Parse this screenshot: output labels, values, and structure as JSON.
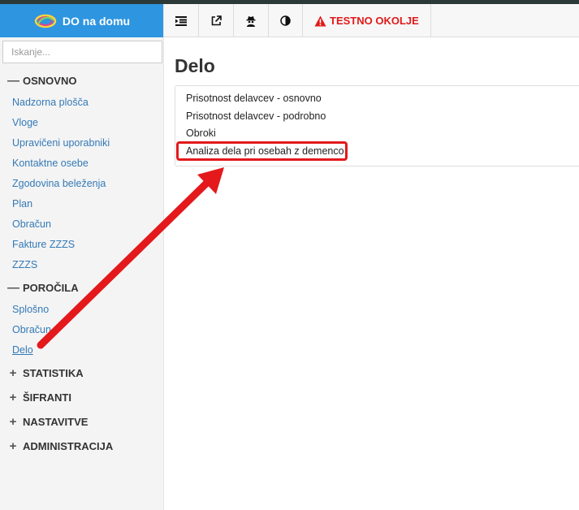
{
  "app": {
    "brand_name": "DO na domu",
    "environment_label": "TESTNO OKOLJE"
  },
  "search": {
    "placeholder": "Iskanje..."
  },
  "sidebar": {
    "sections": [
      {
        "sign": "—",
        "label": "OSNOVNO"
      },
      {
        "sign": "—",
        "label": "POROČILA"
      },
      {
        "sign": "+",
        "label": "STATISTIKA"
      },
      {
        "sign": "+",
        "label": "ŠIFRANTI"
      },
      {
        "sign": "+",
        "label": "NASTAVITVE"
      },
      {
        "sign": "+",
        "label": "ADMINISTRACIJA"
      }
    ],
    "osnovno_items": [
      "Nadzorna plošča",
      "Vloge",
      "Upravičeni uporabniki",
      "Kontaktne osebe",
      "Zgodovina beleženja",
      "Plan",
      "Obračun",
      "Fakture ZZZS",
      "ZZZS"
    ],
    "porocila_items": [
      "Splošno",
      "Obračun",
      "Delo"
    ],
    "active_item": "Delo"
  },
  "toolbar": {
    "icons": [
      "menu-toggle-icon",
      "external-link-icon",
      "user-secret-icon",
      "contrast-icon",
      "warning-icon"
    ]
  },
  "main": {
    "title": "Delo",
    "reports": [
      "Prisotnost delavcev - osnovno",
      "Prisotnost delavcev - podrobno",
      "Obroki",
      "Analiza dela pri osebah z demenco"
    ],
    "highlighted_report": "Analiza dela pri osebah z demenco"
  },
  "annotation": {
    "color": "#e3191c"
  },
  "colors": {
    "brand": "#2e95e0",
    "link": "#337ab7",
    "warning": "#e01a1a"
  }
}
